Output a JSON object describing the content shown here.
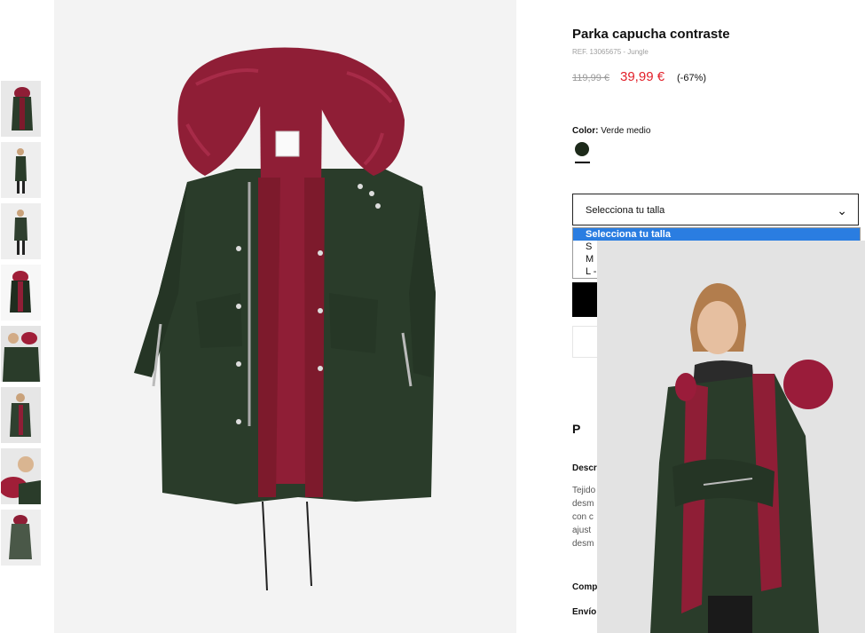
{
  "product": {
    "title": "Parka capucha contraste",
    "ref": "REF. 13065675 - Jungle",
    "old_price": "119,99 €",
    "new_price": "39,99 €",
    "discount": "(-67%)",
    "color_label": "Color:",
    "color_value": "Verde medio",
    "swatch_color": "#1d2a1a"
  },
  "size": {
    "select_label": "Selecciona tu talla",
    "options": [
      "Selecciona tu talla",
      "S",
      "M",
      "L -"
    ]
  },
  "sections": {
    "pin_icon": "P",
    "description_title": "Descr",
    "description_lines": [
      "Tejido",
      "desm",
      "con c",
      "ajust",
      "desm"
    ],
    "composition_title": "Comp",
    "shipping_title": "Envío"
  },
  "colors": {
    "price_red": "#e2202a",
    "parka_green": "#2a3c2a",
    "fur_red": "#8f1e36",
    "dropdown_highlight": "#2a7de1"
  },
  "thumbnails": [
    "thumb-1",
    "thumb-2",
    "thumb-3",
    "thumb-4",
    "thumb-5",
    "thumb-6",
    "thumb-7",
    "thumb-8"
  ]
}
